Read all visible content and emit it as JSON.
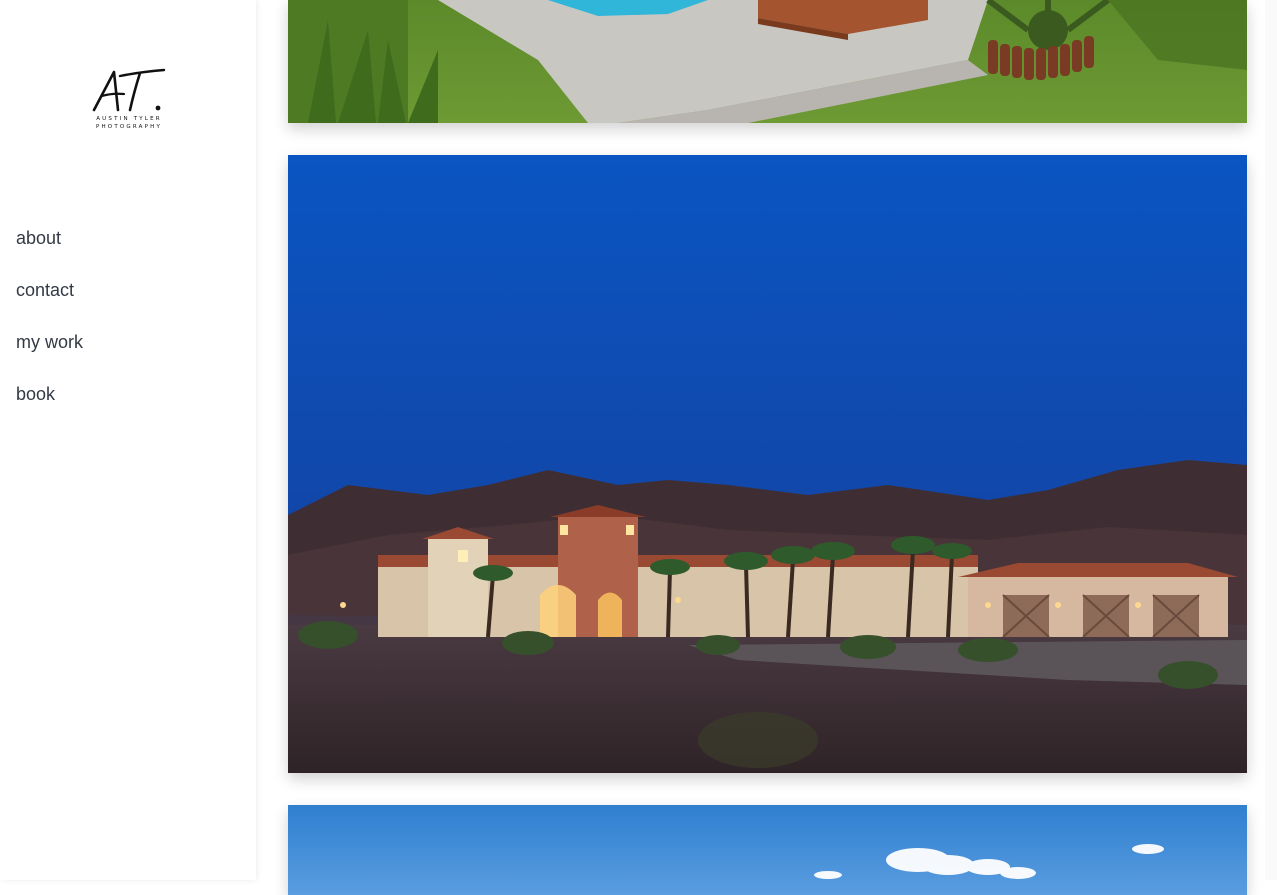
{
  "brand": {
    "monogram": "AT.",
    "name_line": "AUSTIN TYLER",
    "tagline": "PHOTOGRAPHY"
  },
  "nav": {
    "items": [
      {
        "label": "about"
      },
      {
        "label": "contact"
      },
      {
        "label": "my work"
      },
      {
        "label": "book"
      }
    ]
  },
  "gallery": {
    "photos": [
      {
        "subject": "pool-and-lawn"
      },
      {
        "subject": "desert-villa-at-dusk"
      },
      {
        "subject": "blue-sky-with-clouds"
      }
    ]
  }
}
